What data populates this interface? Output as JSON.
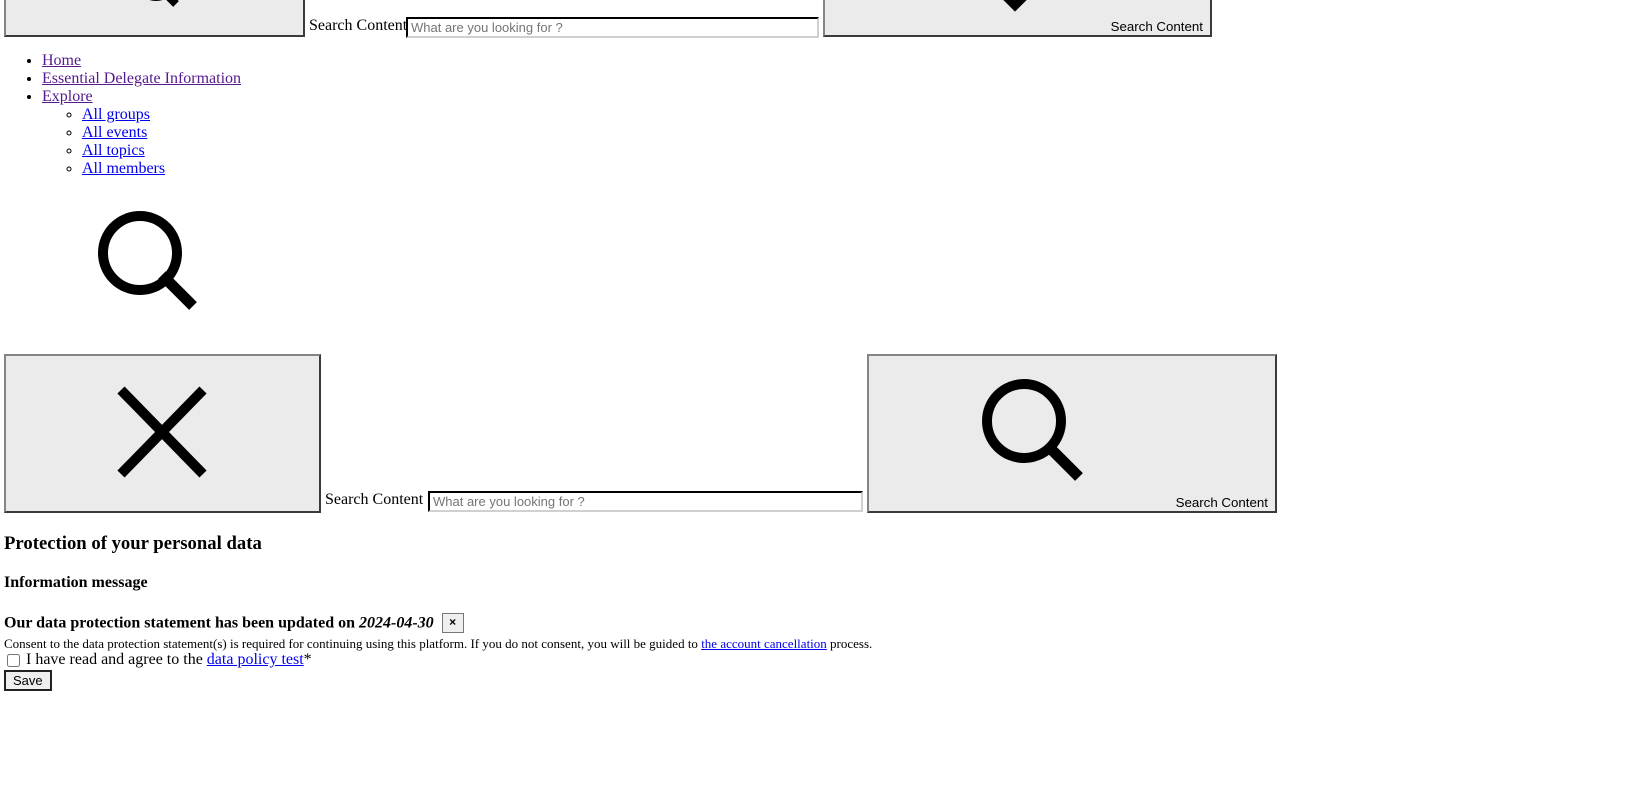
{
  "top_search": {
    "label": "Search Content",
    "placeholder": "What are you looking for ?",
    "submit_label": "Search Content"
  },
  "nav": {
    "items": [
      {
        "label": "Home"
      },
      {
        "label": "Essential Delegate Information"
      },
      {
        "label": "Explore"
      }
    ],
    "explore_children": [
      {
        "label": "All groups"
      },
      {
        "label": "All events"
      },
      {
        "label": "All topics"
      },
      {
        "label": "All members"
      }
    ]
  },
  "search_panel": {
    "label": "Search Content",
    "placeholder": "What are you looking for ?",
    "submit_label": "Search Content"
  },
  "data_protection": {
    "title": "Protection of your personal data",
    "info_heading": "Information message",
    "updated_text": "Our data protection statement has been updated on",
    "updated_date": "2024-04-30",
    "close_label": "×",
    "consent_before": "Consent to the data protection statement(s) is required for continuing using this platform. If you do not consent, you will be guided to",
    "consent_link": "the account cancellation",
    "consent_after": "process.",
    "agree_text": "I have read and agree to the",
    "agree_link": "data policy test",
    "required_mark": "*",
    "save_label": "Save"
  },
  "icons": {
    "search": "search-icon",
    "close": "close-icon",
    "chevron": "chevron-down-icon"
  }
}
